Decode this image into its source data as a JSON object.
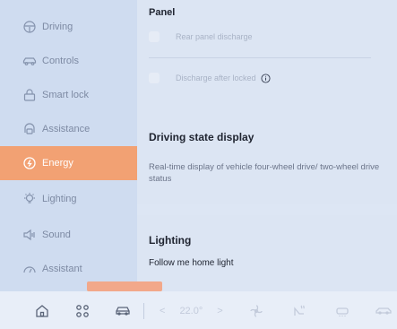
{
  "sidebar": {
    "items": [
      {
        "label": "Driving",
        "icon": "steering-wheel-icon"
      },
      {
        "label": "Controls",
        "icon": "car-controls-icon"
      },
      {
        "label": "Smart lock",
        "icon": "lock-icon"
      },
      {
        "label": "Assistance",
        "icon": "assistance-icon"
      },
      {
        "label": "Energy",
        "icon": "energy-icon"
      },
      {
        "label": "Lighting",
        "icon": "light-bulb-icon"
      },
      {
        "label": "Sound",
        "icon": "speaker-icon"
      },
      {
        "label": "Assistant",
        "icon": "assistant-icon"
      }
    ],
    "active_index": 4
  },
  "main": {
    "panel": {
      "title": "Panel",
      "rows": [
        {
          "label": "Rear panel discharge"
        },
        {
          "label": "Discharge after locked"
        }
      ]
    },
    "driving_state": {
      "title": "Driving state display",
      "description": "Real-time display of vehicle four-wheel drive/ two-wheel drive status"
    },
    "lighting": {
      "title": "Lighting",
      "subtitle": "Follow me home light"
    }
  },
  "dock": {
    "temperature": "22.0°",
    "left_arrow": "<",
    "right_arrow": ">"
  },
  "colors": {
    "accent": "#f2a173",
    "sidebar_bg": "#cfdcf0",
    "content_bg": "#dce5f3"
  }
}
